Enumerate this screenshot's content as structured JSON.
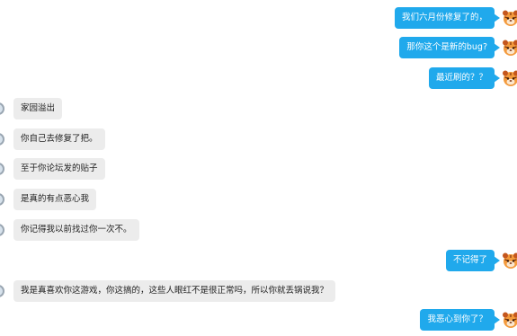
{
  "messages": [
    {
      "side": "right",
      "text": "我们六月份修复了的，"
    },
    {
      "side": "right",
      "text": "那你这个是新的bug?"
    },
    {
      "side": "right",
      "text": "最近刷的？？"
    },
    {
      "side": "left",
      "text": "家园溢出"
    },
    {
      "side": "left",
      "text": "你自己去修复了把。"
    },
    {
      "side": "left",
      "text": "至于你论坛发的贴子"
    },
    {
      "side": "left",
      "text": "是真的有点恶心我"
    },
    {
      "side": "left",
      "text": "你记得我以前找过你一次不。"
    },
    {
      "side": "right",
      "text": "不记得了"
    },
    {
      "side": "left",
      "text": "我是真喜欢你这游戏，你这搞的，这些人眼红不是很正常吗，所以你就丢锅说我？"
    },
    {
      "side": "right",
      "text": "我恶心到你了？"
    }
  ],
  "colors": {
    "outgoing_bubble": "#20a9ec",
    "incoming_bubble": "#ececec"
  },
  "icons": {
    "right_avatar": "tiger-face-avatar",
    "left_avatar": "round-avatar"
  }
}
